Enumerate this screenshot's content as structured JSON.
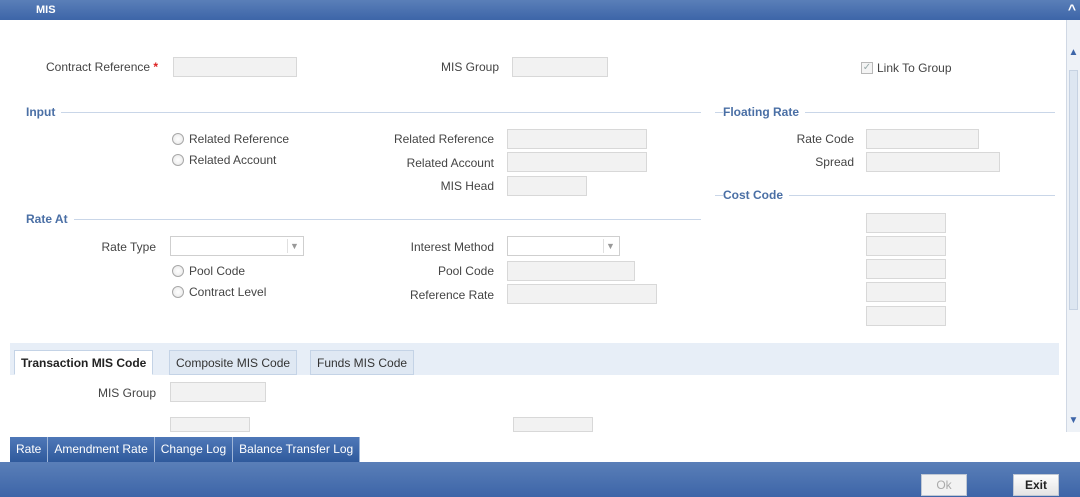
{
  "window": {
    "title": "MIS",
    "close_glyph": "✕"
  },
  "header": {
    "contract_reference_label": "Contract Reference",
    "required_marker": "*",
    "contract_reference_value": "",
    "mis_group_label": "MIS Group",
    "mis_group_value": "",
    "link_to_group_label": "Link To Group",
    "link_to_group_checked": true
  },
  "input_section": {
    "title": "Input",
    "radio_related_reference": "Related Reference",
    "radio_related_account": "Related Account",
    "related_reference_label": "Related Reference",
    "related_account_label": "Related Account",
    "mis_head_label": "MIS Head",
    "related_reference_value": "",
    "related_account_value": "",
    "mis_head_value": ""
  },
  "floating_rate": {
    "title": "Floating Rate",
    "rate_code_label": "Rate Code",
    "spread_label": "Spread",
    "rate_code_value": "",
    "spread_value": ""
  },
  "cost_code": {
    "title": "Cost Code",
    "fields": [
      "",
      "",
      "",
      "",
      ""
    ]
  },
  "rate_at": {
    "title": "Rate At",
    "rate_type_label": "Rate Type",
    "rate_type_value": "",
    "radio_pool_code": "Pool Code",
    "radio_contract_level": "Contract Level",
    "interest_method_label": "Interest Method",
    "interest_method_value": "",
    "pool_code_label": "Pool Code",
    "reference_rate_label": "Reference Rate",
    "pool_code_value": "",
    "reference_rate_value": ""
  },
  "tabs": [
    {
      "label": "Transaction MIS Code",
      "active": true
    },
    {
      "label": "Composite MIS Code",
      "active": false
    },
    {
      "label": "Funds MIS Code",
      "active": false
    }
  ],
  "transaction_mis": {
    "mis_group_label": "MIS Group",
    "mis_group_value": ""
  },
  "toolbar": [
    "Rate",
    "Amendment Rate",
    "Change Log",
    "Balance Transfer Log"
  ],
  "footer": {
    "ok_label": "Ok",
    "exit_label": "Exit"
  },
  "colors": {
    "titlebar": "#3d65a8",
    "section_title": "#4a6fa5",
    "required": "#dd2222"
  },
  "icons": {
    "scroll_up": "chevron-up-icon",
    "scroll_down": "chevron-down-icon",
    "dropdown": "chevron-down-icon"
  }
}
